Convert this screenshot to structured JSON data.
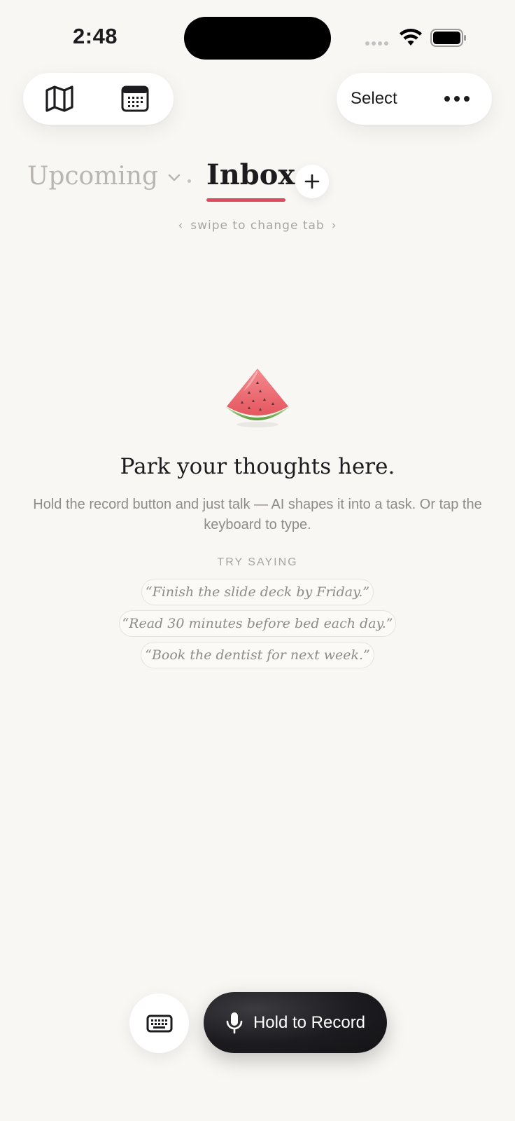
{
  "status_bar": {
    "time": "2:48"
  },
  "top_bar": {
    "left_icons": [
      "map-icon",
      "calendar-icon"
    ],
    "select_label": "Select",
    "more_label": "•••"
  },
  "tabs": {
    "upcoming_label": "Upcoming",
    "inbox_label": "Inbox",
    "add_label": "+",
    "swipe_hint": "swipe to change tab",
    "accent_color": "#e04a5f"
  },
  "empty_state": {
    "icon": "watermelon-icon",
    "title": "Park your thoughts here.",
    "description": "Hold the record button and just talk — AI shapes it into a task. Or tap the keyboard to type.",
    "try_label": "TRY SAYING",
    "examples": [
      "“Finish the slide deck by Friday.”",
      "“Read 30 minutes before bed each day.”",
      "“Book the dentist for next week.”"
    ]
  },
  "bottom_bar": {
    "keyboard_icon": "keyboard-icon",
    "record_label": "Hold to Record"
  }
}
